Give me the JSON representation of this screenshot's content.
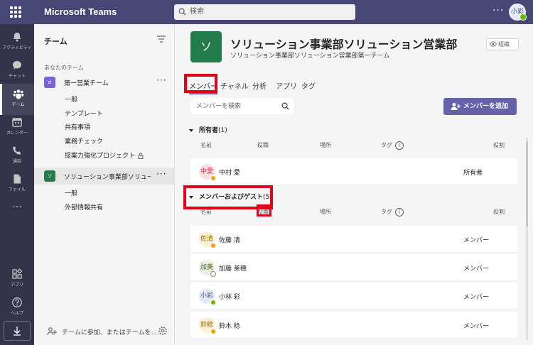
{
  "app": {
    "title": "Microsoft Teams",
    "search_placeholder": "検索",
    "more": "···",
    "user_initials": "小彩"
  },
  "rail": [
    {
      "label": "アクティビティ",
      "icon": "bell-icon"
    },
    {
      "label": "チャット",
      "icon": "chat-icon"
    },
    {
      "label": "チーム",
      "icon": "teams-icon",
      "active": true
    },
    {
      "label": "カレンダー",
      "icon": "calendar-icon"
    },
    {
      "label": "通話",
      "icon": "phone-icon"
    },
    {
      "label": "ファイル",
      "icon": "file-icon"
    },
    {
      "label": "アプリ",
      "icon": "apps-icon"
    },
    {
      "label": "ヘルプ",
      "icon": "help-icon"
    }
  ],
  "rail_more": "···",
  "sidebar": {
    "title": "チーム",
    "section_label": "あなたのチーム",
    "teams": [
      {
        "initial": "d",
        "name": "第一営業チーム",
        "color": "#7b61d9",
        "more": "···",
        "channels": [
          "一般",
          "テンプレート",
          "共有事項",
          "業務チェック",
          "提案力強化プロジェクト"
        ]
      },
      {
        "initial": "ソ",
        "name": "ソリューション事業部ソリュー...",
        "color": "#237b4b",
        "more": "···",
        "channels": [
          "一般",
          "外部情報共有"
        ]
      }
    ],
    "join_text": "チームに参加、またはチームを..."
  },
  "header": {
    "avatar_initial": "ソ",
    "title": "ソリューション事業部ソリューション営業部第一...",
    "subtitle": "ソリューション事業部ソリューション営業部第一チーム",
    "org_button": "組織"
  },
  "tabs": [
    "メンバー",
    "チャネル",
    "分析",
    "アプリ",
    "タグ"
  ],
  "member_search_placeholder": "メンバーを検索",
  "add_member_label": "メンバーを追加",
  "columns": {
    "name": "名前",
    "title": "役職",
    "location": "場所",
    "tags": "タグ",
    "role": "役割",
    "info": "i"
  },
  "owners": {
    "label": "所有者",
    "count": "(1)",
    "members": [
      {
        "initials": "中愛",
        "name": "中村 愛",
        "role": "所有者",
        "bg": "#fde0e0",
        "fg": "#c4314b",
        "status": "#f8a300"
      }
    ]
  },
  "guests": {
    "label": "メンバーおよびゲスト",
    "count": "(5)",
    "members": [
      {
        "initials": "佐清",
        "name": "佐藤 清",
        "role": "メンバー",
        "bg": "#fdf0d5",
        "fg": "#8a6a00",
        "status": "#f8a300"
      },
      {
        "initials": "加美",
        "name": "加藤 美穂",
        "role": "メンバー",
        "bg": "#e8f0e0",
        "fg": "#4f6b2f",
        "status": "#ffffff"
      },
      {
        "initials": "小彩",
        "name": "小林 彩",
        "role": "メンバー",
        "bg": "#e3eaf3",
        "fg": "#3a5a7c",
        "status": "#6bb700"
      },
      {
        "initials": "鈴稔",
        "name": "鈴木 稔",
        "role": "メンバー",
        "bg": "#fdf0d5",
        "fg": "#8a6a00",
        "status": "#f8a300"
      }
    ]
  }
}
